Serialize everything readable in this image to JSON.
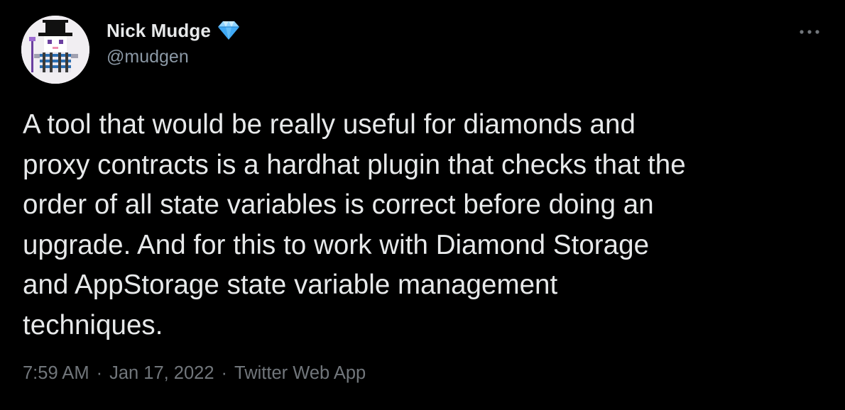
{
  "author": {
    "display_name": "Nick Mudge",
    "handle": "@mudgen",
    "avatar": "pixel-art-avatar",
    "verified_icon": "diamond-icon"
  },
  "tweet": {
    "text": "A tool that would be really useful for diamonds and\nproxy contracts is a hardhat plugin that checks that the\norder of all state variables is correct before doing an\nupgrade. And for this to work with Diamond Storage\nand AppStorage state variable management\ntechniques."
  },
  "meta": {
    "time": "7:59 AM",
    "separator_1": "·",
    "date": "Jan 17, 2022",
    "separator_2": "·",
    "source": "Twitter Web App"
  },
  "more_icon": "more-horizontal-icon",
  "colors": {
    "background": "#000000",
    "primary_text": "#e7e9ea",
    "secondary_text": "#71767b",
    "diamond": "#3fa9f5"
  }
}
